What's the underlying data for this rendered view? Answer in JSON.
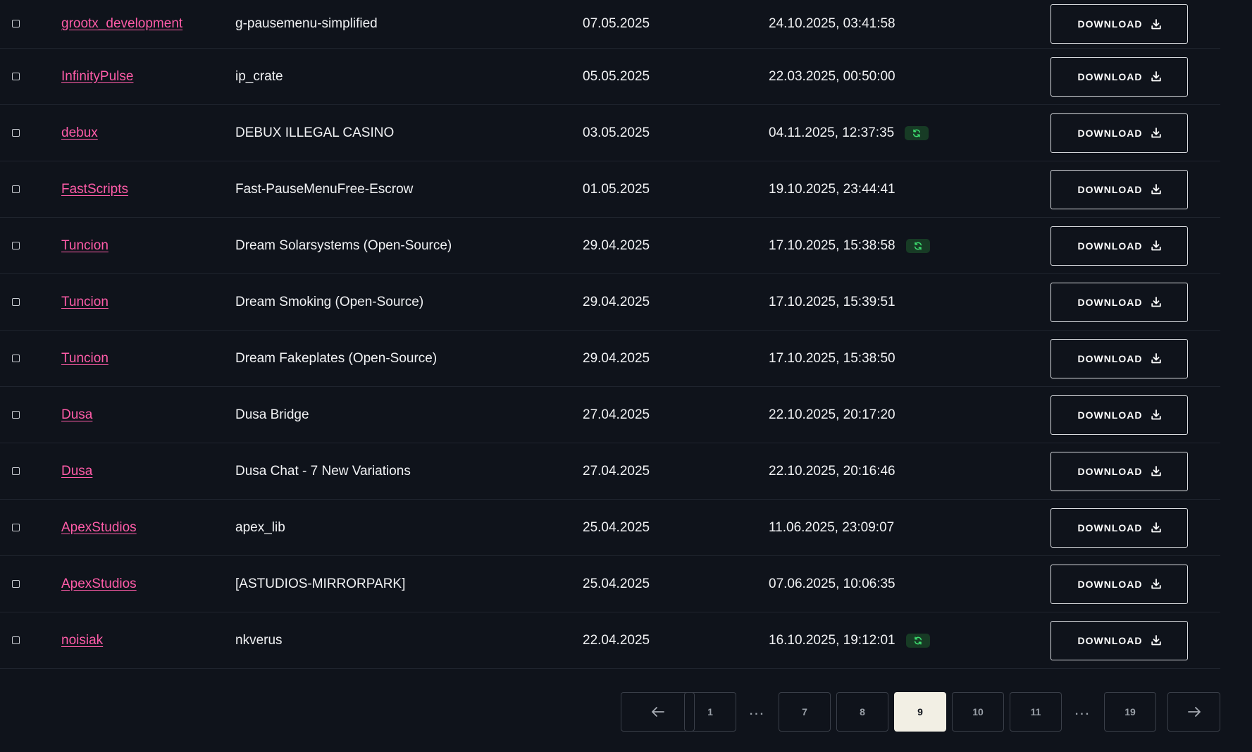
{
  "table": {
    "rows": [
      {
        "author": "grootx_development",
        "resource": "g-pausemenu-simplified",
        "created": "07.05.2025",
        "updated": "24.10.2025, 03:41:58",
        "synced": false
      },
      {
        "author": "InfinityPulse",
        "resource": "ip_crate",
        "created": "05.05.2025",
        "updated": "22.03.2025, 00:50:00",
        "synced": false
      },
      {
        "author": "debux",
        "resource": "DEBUX ILLEGAL CASINO",
        "created": "03.05.2025",
        "updated": "04.11.2025, 12:37:35",
        "synced": true
      },
      {
        "author": "FastScripts",
        "resource": "Fast-PauseMenuFree-Escrow",
        "created": "01.05.2025",
        "updated": "19.10.2025, 23:44:41",
        "synced": false
      },
      {
        "author": "Tuncion",
        "resource": "Dream Solarsystems (Open-Source)",
        "created": "29.04.2025",
        "updated": "17.10.2025, 15:38:58",
        "synced": true
      },
      {
        "author": "Tuncion",
        "resource": "Dream Smoking (Open-Source)",
        "created": "29.04.2025",
        "updated": "17.10.2025, 15:39:51",
        "synced": false
      },
      {
        "author": "Tuncion",
        "resource": "Dream Fakeplates (Open-Source)",
        "created": "29.04.2025",
        "updated": "17.10.2025, 15:38:50",
        "synced": false
      },
      {
        "author": "Dusa",
        "resource": "Dusa Bridge",
        "created": "27.04.2025",
        "updated": "22.10.2025, 20:17:20",
        "synced": false
      },
      {
        "author": "Dusa",
        "resource": "Dusa Chat - 7 New Variations",
        "created": "27.04.2025",
        "updated": "22.10.2025, 20:16:46",
        "synced": false
      },
      {
        "author": "ApexStudios",
        "resource": "apex_lib",
        "created": "25.04.2025",
        "updated": "11.06.2025, 23:09:07",
        "synced": false
      },
      {
        "author": "ApexStudios",
        "resource": "[ASTUDIOS-MIRRORPARK]",
        "created": "25.04.2025",
        "updated": "07.06.2025, 10:06:35",
        "synced": false
      },
      {
        "author": "noisiak",
        "resource": "nkverus",
        "created": "22.04.2025",
        "updated": "16.10.2025, 19:12:01",
        "synced": true
      }
    ],
    "download_label": "DOWNLOAD",
    "sync_icon": "refresh-icon",
    "download_icon": "download-icon"
  },
  "pagination": {
    "prev_icon": "arrow-left-icon",
    "next_icon": "arrow-right-icon",
    "ellipsis": "...",
    "pages": [
      "1",
      "7",
      "8",
      "9",
      "10",
      "11",
      "19"
    ],
    "current": "9"
  },
  "colors": {
    "background": "#0f131b",
    "author_link": "#ff5ca8",
    "active_page": "#f2efe4",
    "sync_badge": "#173b25",
    "sync_icon": "#3ddc6f"
  }
}
